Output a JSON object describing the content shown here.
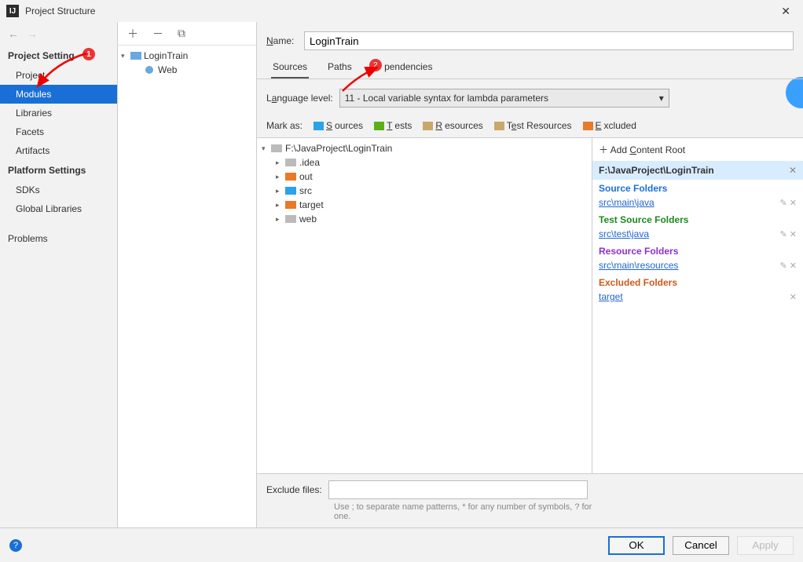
{
  "window": {
    "title": "Project Structure"
  },
  "sidebar": {
    "sections": [
      {
        "title": "Project Setting",
        "badge": "1",
        "items": [
          "Project",
          "Modules",
          "Libraries",
          "Facets",
          "Artifacts"
        ],
        "selected": "Modules"
      },
      {
        "title": "Platform Settings",
        "items": [
          "SDKs",
          "Global Libraries"
        ]
      },
      {
        "title": "",
        "items": [
          "Problems"
        ]
      }
    ]
  },
  "module_tree": {
    "root": {
      "label": "LoginTrain",
      "expanded": true,
      "children": [
        {
          "label": "Web"
        }
      ]
    }
  },
  "name_field": {
    "label": "Name:",
    "value": "LoginTrain"
  },
  "tabs": {
    "items": [
      "Sources",
      "Paths",
      "Dependencies"
    ],
    "active": "Sources",
    "badge": "2"
  },
  "language_level": {
    "label": "Language level:",
    "value": "11 - Local variable syntax for lambda parameters"
  },
  "mark_as": {
    "label": "Mark as:",
    "items": [
      {
        "label": "Sources",
        "color": "#2aa3e8"
      },
      {
        "label": "Tests",
        "color": "#5bb017"
      },
      {
        "label": "Resources",
        "color": "#b78a4a"
      },
      {
        "label": "Test Resources",
        "color": "#b78a4a"
      },
      {
        "label": "Excluded",
        "color": "#e87b2a"
      }
    ]
  },
  "content_tree": {
    "root": "F:\\JavaProject\\LoginTrain",
    "children": [
      {
        "label": ".idea",
        "color": "#999"
      },
      {
        "label": "out",
        "color": "#e87b2a"
      },
      {
        "label": "src",
        "color": "#2aa3e8"
      },
      {
        "label": "target",
        "color": "#e87b2a"
      },
      {
        "label": "web",
        "color": "#999"
      }
    ]
  },
  "content_roots": {
    "add_label": "Add Content Root",
    "path": "F:\\JavaProject\\LoginTrain",
    "groups": [
      {
        "title": "Source Folders",
        "color": "#1a6fd6",
        "items": [
          "src\\main\\java"
        ]
      },
      {
        "title": "Test Source Folders",
        "color": "#1c8a1c",
        "items": [
          "src\\test\\java"
        ]
      },
      {
        "title": "Resource Folders",
        "color": "#8a2fd6",
        "items": [
          "src\\main\\resources"
        ]
      },
      {
        "title": "Excluded Folders",
        "color": "#cc5a1a",
        "items": [
          "target"
        ]
      }
    ]
  },
  "exclude": {
    "label": "Exclude files:",
    "value": "",
    "hint": "Use ; to separate name patterns, * for any number of symbols, ? for one."
  },
  "footer": {
    "ok": "OK",
    "cancel": "Cancel",
    "apply": "Apply"
  }
}
